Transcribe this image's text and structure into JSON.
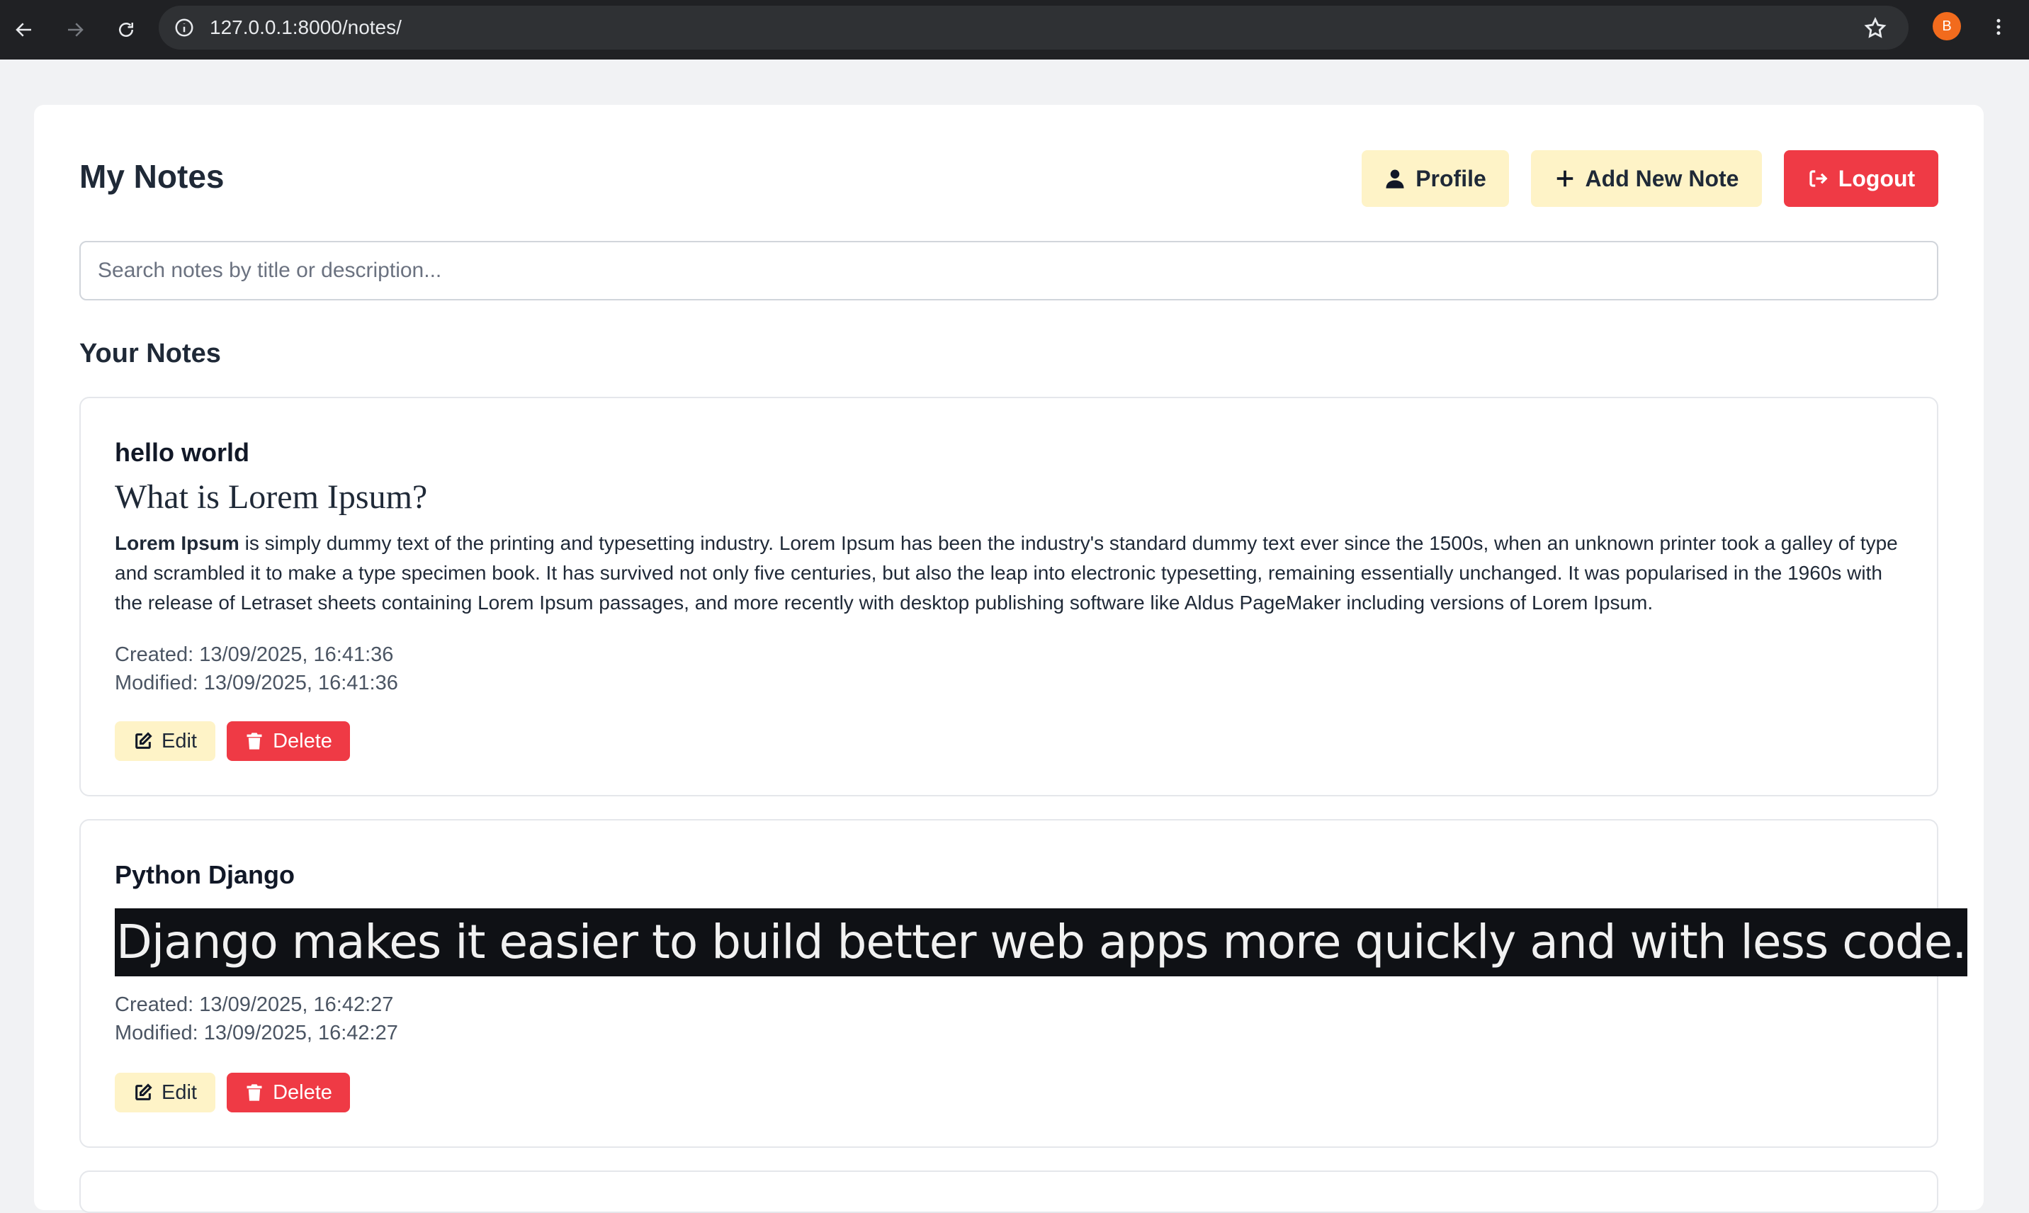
{
  "browser": {
    "url": "127.0.0.1:8000/notes/",
    "profile_initial": "B"
  },
  "header": {
    "title": "My Notes",
    "profile_label": "Profile",
    "add_label": "Add New Note",
    "logout_label": "Logout"
  },
  "search": {
    "placeholder": "Search notes by title or description..."
  },
  "section_title": "Your Notes",
  "notes": [
    {
      "title": "hello world",
      "heading": "What is Lorem Ipsum?",
      "bold_lead": "Lorem Ipsum",
      "body": " is simply dummy text of the printing and typesetting industry. Lorem Ipsum has been the industry's standard dummy text ever since the 1500s, when an unknown printer took a galley of type and scrambled it to make a type specimen book. It has survived not only five centuries, but also the leap into electronic typesetting, remaining essentially unchanged. It was popularised in the 1960s with the release of Letraset sheets containing Lorem Ipsum passages, and more recently with desktop publishing software like Aldus PageMaker including versions of Lorem Ipsum.",
      "created": "Created: 13/09/2025, 16:41:36",
      "modified": "Modified: 13/09/2025, 16:41:36",
      "edit_label": "Edit",
      "delete_label": "Delete"
    },
    {
      "title": "Python Django",
      "highlight": "Django makes it easier to build better web apps more quickly and with less code.",
      "created": "Created: 13/09/2025, 16:42:27",
      "modified": "Modified: 13/09/2025, 16:42:27",
      "edit_label": "Edit",
      "delete_label": "Delete"
    }
  ],
  "colors": {
    "accent_yellow": "#fef3c7",
    "danger_red": "#ef3a45",
    "page_bg": "#f1f2f4"
  }
}
